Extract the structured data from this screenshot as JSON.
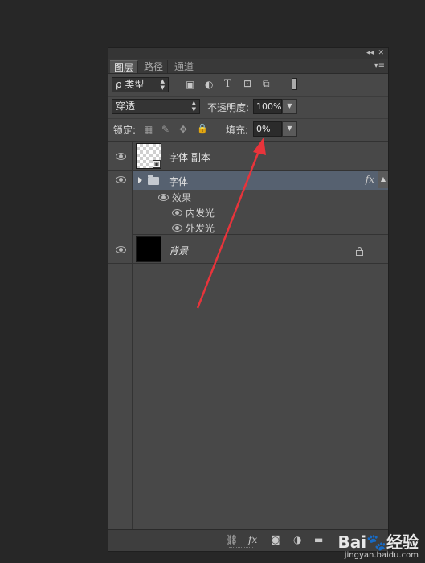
{
  "panel": {
    "collapse_glyph": "◂◂",
    "close_glyph": "✕",
    "tabs": [
      {
        "label": "图层",
        "active": true
      },
      {
        "label": "路径",
        "active": false
      },
      {
        "label": "通道",
        "active": false
      }
    ],
    "menu_glyph": "▾≡"
  },
  "filter": {
    "kind_label": "ρ 类型",
    "icons": [
      "image-filter-icon",
      "adjustment-filter-icon",
      "type-filter-icon",
      "shape-filter-icon",
      "smartobject-filter-icon"
    ],
    "icon_glyphs": [
      "▣",
      "◐",
      "T",
      "⊡",
      "⧉"
    ]
  },
  "blend": {
    "mode": "穿透",
    "opacity_label": "不透明度:",
    "opacity_value": "100%"
  },
  "lock": {
    "label": "锁定:",
    "icon_glyphs": [
      "▦",
      "✎",
      "✥",
      "🔒"
    ],
    "fill_label": "填充:",
    "fill_value": "0%"
  },
  "layers": [
    {
      "name": "字体 副本",
      "type": "smart-object",
      "visible": true
    },
    {
      "name": "字体",
      "type": "group",
      "visible": true,
      "selected": true,
      "fx": "fx"
    },
    {
      "name": "效果",
      "type": "effects-header",
      "visible": true
    },
    {
      "name": "内发光",
      "type": "effect",
      "visible": true
    },
    {
      "name": "外发光",
      "type": "effect",
      "visible": true
    },
    {
      "name": "背景",
      "type": "background",
      "visible": true,
      "locked": true
    }
  ],
  "footer": {
    "icons": [
      "link-layers-icon",
      "fx-icon",
      "mask-icon",
      "adjustment-icon",
      "new-group-icon",
      "new-layer-icon",
      "delete-icon"
    ],
    "icon_glyphs": [
      "⛓",
      "fx",
      "◙",
      "◑",
      "▬",
      "▢",
      "🗑"
    ]
  },
  "annotation": {
    "color": "#e8343b"
  },
  "watermark": {
    "logo": "Bai🐾经验",
    "url": "jingyan.baidu.com"
  }
}
